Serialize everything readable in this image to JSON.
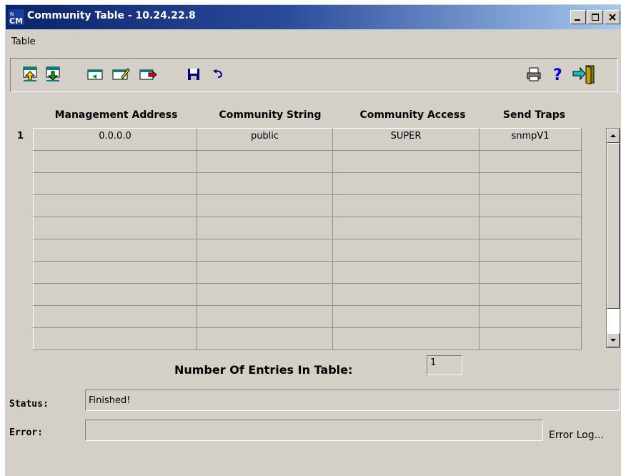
{
  "window": {
    "title": "Community Table  - 10.24.22.8",
    "app_icon": "cm-app-icon",
    "controls": [
      "minimize-icon",
      "maximize-icon",
      "close-icon"
    ]
  },
  "menubar": {
    "items": [
      {
        "label": "Table"
      }
    ]
  },
  "toolbar": {
    "buttons": [
      {
        "name": "upload-table-icon"
      },
      {
        "name": "download-table-icon"
      },
      {
        "name": "add-row-icon"
      },
      {
        "name": "edit-row-icon"
      },
      {
        "name": "delete-row-icon"
      },
      {
        "name": "save-icon"
      },
      {
        "name": "undo-icon"
      },
      {
        "name": "print-icon"
      },
      {
        "name": "help-icon"
      },
      {
        "name": "exit-icon"
      }
    ]
  },
  "table": {
    "columns": [
      "Management Address",
      "Community String",
      "Community Access",
      "Send Traps"
    ],
    "rows": [
      {
        "num": "1",
        "cells": [
          "0.0.0.0",
          "public",
          "SUPER",
          "snmpV1"
        ]
      }
    ],
    "empty_rows": 9
  },
  "entries": {
    "label": "Number Of Entries In Table:",
    "value": "1"
  },
  "status": {
    "label": "Status:",
    "value": "Finished!"
  },
  "error": {
    "label": "Error:",
    "value": "",
    "log_button": "Error Log..."
  },
  "colors": {
    "title_start": "#0a246a",
    "title_end": "#a6caf0",
    "face": "#d4d0c8"
  }
}
